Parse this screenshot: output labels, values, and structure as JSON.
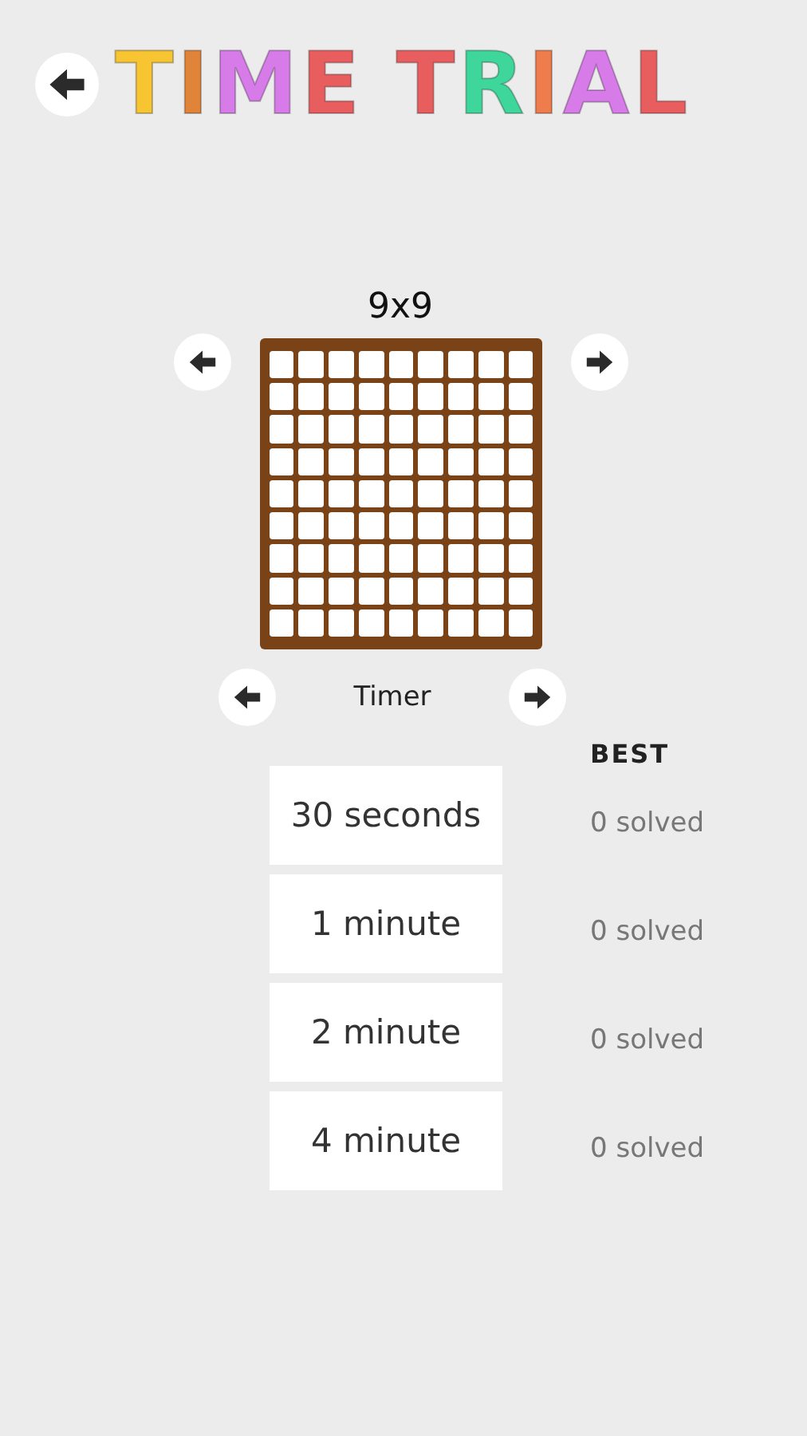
{
  "header": {
    "title": "TIME TRIAL"
  },
  "board_size": "9x9",
  "timer_label": "Timer",
  "best_heading": "BEST",
  "timer_options": [
    {
      "label": "30 seconds",
      "best": "0 solved"
    },
    {
      "label": "1 minute",
      "best": "0 solved"
    },
    {
      "label": "2 minute",
      "best": "0 solved"
    },
    {
      "label": "4 minute",
      "best": "0 solved"
    }
  ]
}
